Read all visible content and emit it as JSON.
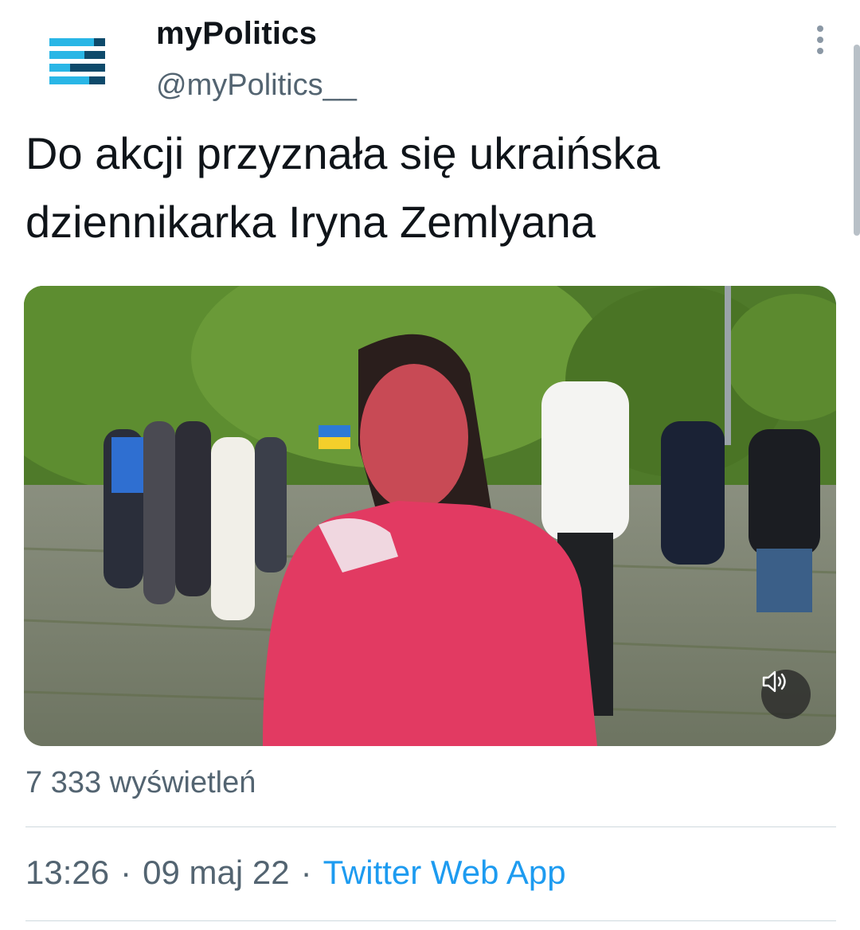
{
  "author": {
    "name": "myPolitics",
    "handle": "@myPolitics__",
    "avatar_icon": "stacked-bars-logo-icon",
    "avatar_colors": [
      "#29b6e6",
      "#0e4a6b"
    ]
  },
  "tweet": {
    "text": "Do akcji przyznała się ukraińska\ndziennikarka Iryna Zemlyana"
  },
  "media": {
    "type": "video",
    "sound_icon": "speaker-muted-icon"
  },
  "stats": {
    "views": "7 333 wyświetleń"
  },
  "meta": {
    "time": "13:26",
    "date": "09 maj 22",
    "separator": "·",
    "source": "Twitter Web App"
  },
  "colors": {
    "text_primary": "#0f1419",
    "text_secondary": "#536471",
    "link": "#1d9bf0",
    "divider": "#cfd9de"
  }
}
